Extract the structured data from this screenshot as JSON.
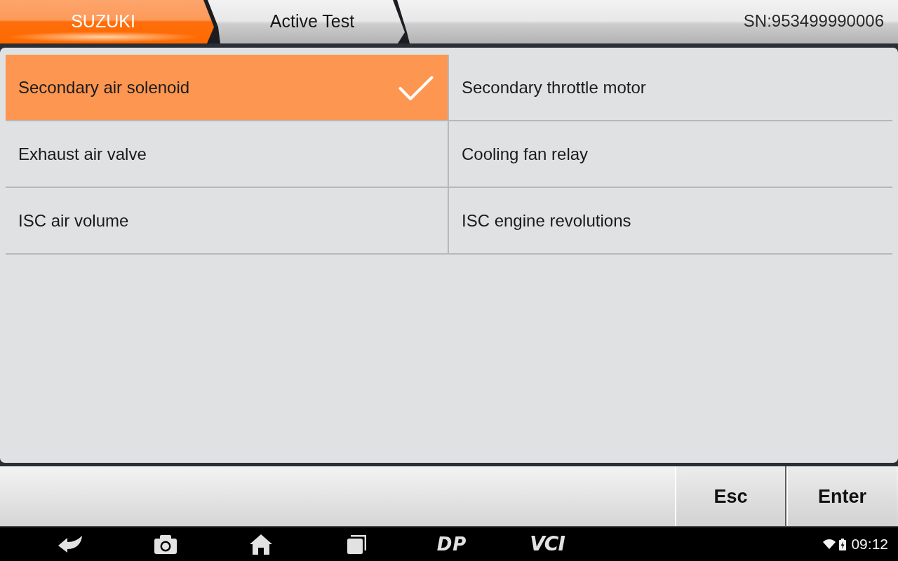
{
  "header": {
    "tabs": [
      {
        "label": "SUZUKI",
        "selected": true
      },
      {
        "label": "Active Test",
        "selected": false
      }
    ],
    "serial": "SN:953499990006"
  },
  "items": [
    {
      "label": "Secondary air solenoid",
      "selected": true
    },
    {
      "label": "Secondary throttle motor",
      "selected": false
    },
    {
      "label": "Exhaust air valve",
      "selected": false
    },
    {
      "label": "Cooling fan relay",
      "selected": false
    },
    {
      "label": "ISC air volume",
      "selected": false
    },
    {
      "label": "ISC engine revolutions",
      "selected": false
    }
  ],
  "toolbar": {
    "buttons": [
      "Esc",
      "Enter"
    ]
  },
  "nav_bar": {
    "logos": [
      "DP",
      "VCI"
    ],
    "time": "09:12"
  }
}
